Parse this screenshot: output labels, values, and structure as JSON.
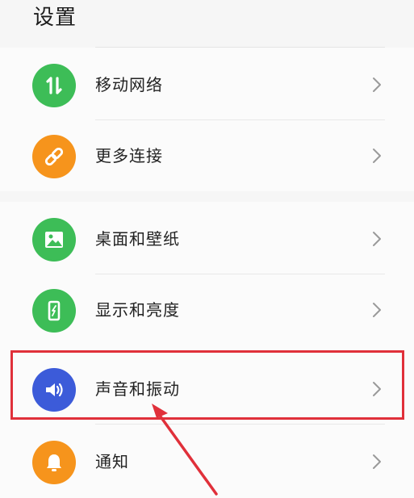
{
  "header": {
    "title": "设置"
  },
  "items": [
    {
      "label": "移动网络",
      "icon": "mobile-network-icon",
      "color": "#3dbd57"
    },
    {
      "label": "更多连接",
      "icon": "link-icon",
      "color": "#f6941c"
    },
    {
      "label": "桌面和壁纸",
      "icon": "wallpaper-icon",
      "color": "#3dbd57"
    },
    {
      "label": "显示和亮度",
      "icon": "display-brightness-icon",
      "color": "#3dbd57"
    },
    {
      "label": "声音和振动",
      "icon": "speaker-icon",
      "color": "#3c5bd9"
    },
    {
      "label": "通知",
      "icon": "bell-icon",
      "color": "#f6941c"
    }
  ],
  "annotation": {
    "highlight_color": "#e0303a",
    "highlighted_item": "声音和振动"
  }
}
